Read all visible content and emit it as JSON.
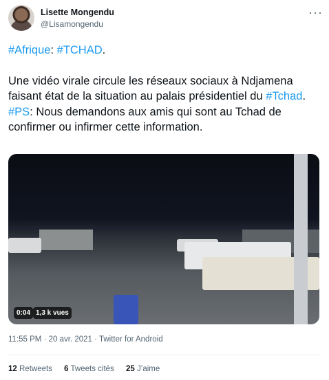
{
  "author": {
    "name": "Lisette Mongendu",
    "handle": "@Lisamongendu"
  },
  "menu_glyph": "···",
  "tweet": {
    "line1": {
      "tag1": "#Afrique",
      "sep": ": ",
      "tag2": "#TCHAD",
      "end": "."
    },
    "para2": {
      "text": "Une vidéo virale circule les réseaux sociaux à Ndjamena faisant état de la situation au palais présidentiel du ",
      "tag": "#Tchad",
      "end": "."
    },
    "para3": {
      "tag": "#PS",
      "text": ": Nous demandons aux amis qui sont au Tchad de confirmer ou infirmer cette information."
    }
  },
  "video": {
    "duration": "0:04",
    "views": "1,3 k vues"
  },
  "meta": {
    "time": "11:55 PM",
    "sep1": " · ",
    "date": "20 avr. 2021",
    "sep2": " · ",
    "source": "Twitter for Android"
  },
  "stats": {
    "retweets_count": "12",
    "retweets_label": " Retweets",
    "quotes_count": "6",
    "quotes_label": " Tweets cités",
    "likes_count": "25",
    "likes_label": " J’aime"
  }
}
